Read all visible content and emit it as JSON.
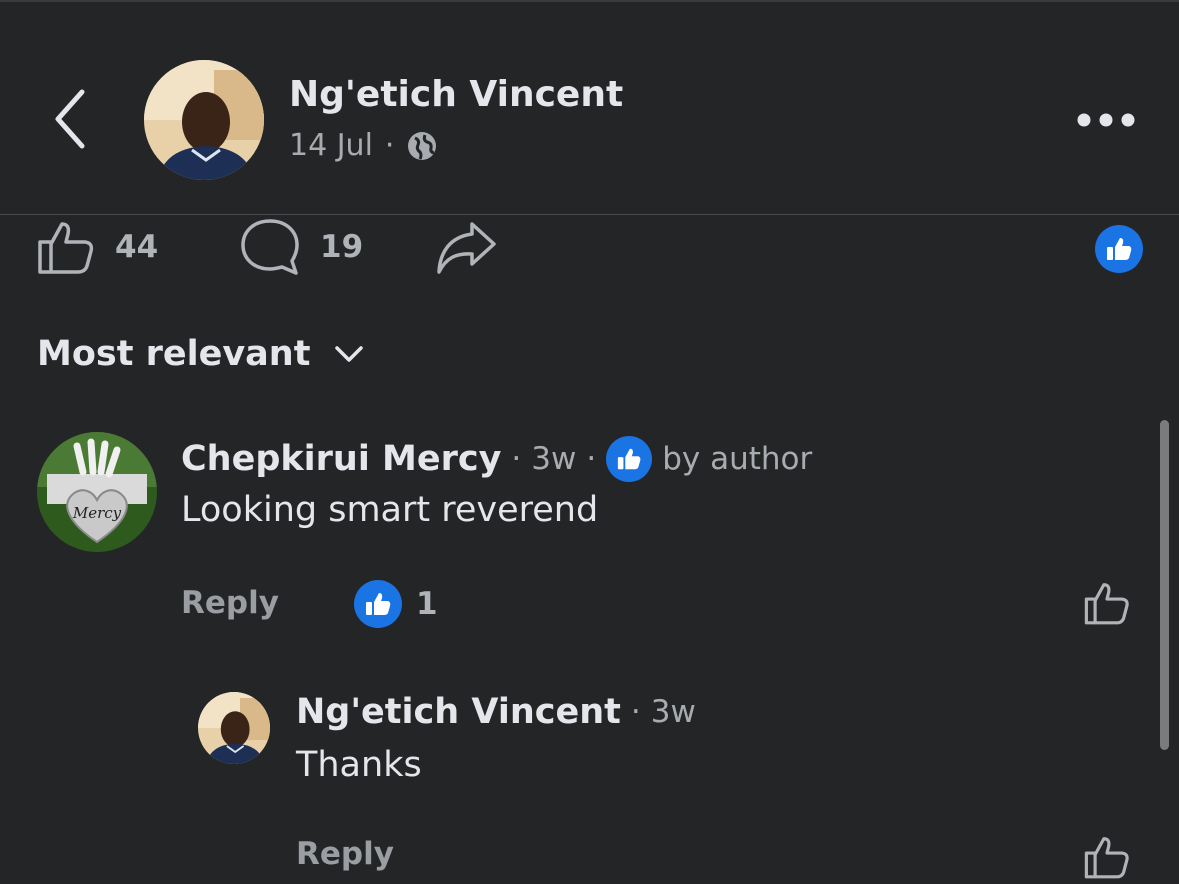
{
  "post": {
    "author": "Ng'etich Vincent",
    "date": "14 Jul",
    "separator": "·"
  },
  "stats": {
    "likes": "44",
    "comments": "19"
  },
  "sort": {
    "label": "Most relevant"
  },
  "comments": [
    {
      "name": "Chepkirui Mercy",
      "sep1": "·",
      "time": "3w",
      "sep2": "·",
      "badge": "by author",
      "text": "Looking smart reverend",
      "reply_label": "Reply",
      "reaction_count": "1",
      "avatar_text": "Mercy"
    },
    {
      "name": "Ng'etich Vincent",
      "sep1": "·",
      "time": "3w",
      "text": "Thanks",
      "reply_label": "Reply"
    }
  ],
  "colors": {
    "background": "#242527",
    "accent": "#1b74e4",
    "text_primary": "#e4e6eb",
    "text_secondary": "#a8abaf"
  },
  "icons": {
    "back": "chevron-left-icon",
    "more": "more-dots-icon",
    "privacy": "globe-icon",
    "like": "thumbs-up-outline-icon",
    "comment": "speech-bubble-icon",
    "share": "share-arrow-icon",
    "reaction": "thumbs-up-badge-icon",
    "sort": "chevron-down-icon"
  }
}
